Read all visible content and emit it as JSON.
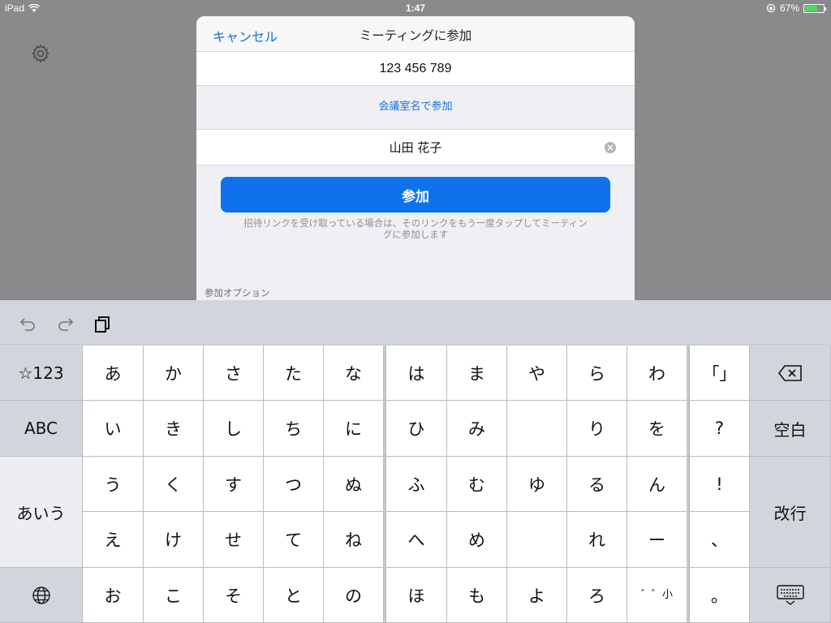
{
  "status_bar": {
    "device": "iPad",
    "time": "1:47",
    "battery_percent": "67%",
    "battery_level": 0.67
  },
  "modal": {
    "cancel_label": "キャンセル",
    "title": "ミーティングに参加",
    "meeting_id": "123 456 789",
    "room_link": "会議室名で参加",
    "name_value": "山田 花子",
    "join_label": "参加",
    "hint_line1": "招待リンクを受け取っている場合は、そのリンクをもう一度タップしてミーティン",
    "hint_line2": "グに参加します",
    "options_label": "参加オプション"
  },
  "keyboard": {
    "mode_123": "☆123",
    "mode_abc": "ABC",
    "mode_kana": "あいう",
    "space": "空白",
    "return": "改行",
    "rows": [
      [
        "あ",
        "か",
        "さ",
        "た",
        "な",
        "は",
        "ま",
        "や",
        "ら",
        "わ",
        "「」"
      ],
      [
        "い",
        "き",
        "し",
        "ち",
        "に",
        "ひ",
        "み",
        "",
        "り",
        "を",
        "?"
      ],
      [
        "う",
        "く",
        "す",
        "つ",
        "ぬ",
        "ふ",
        "む",
        "ゆ",
        "る",
        "ん",
        "!"
      ],
      [
        "え",
        "け",
        "せ",
        "て",
        "ね",
        "へ",
        "め",
        "",
        "れ",
        "ー",
        "、"
      ],
      [
        "お",
        "こ",
        "そ",
        "と",
        "の",
        "ほ",
        "も",
        "よ",
        "ろ",
        "゛゜小",
        "。"
      ]
    ]
  }
}
